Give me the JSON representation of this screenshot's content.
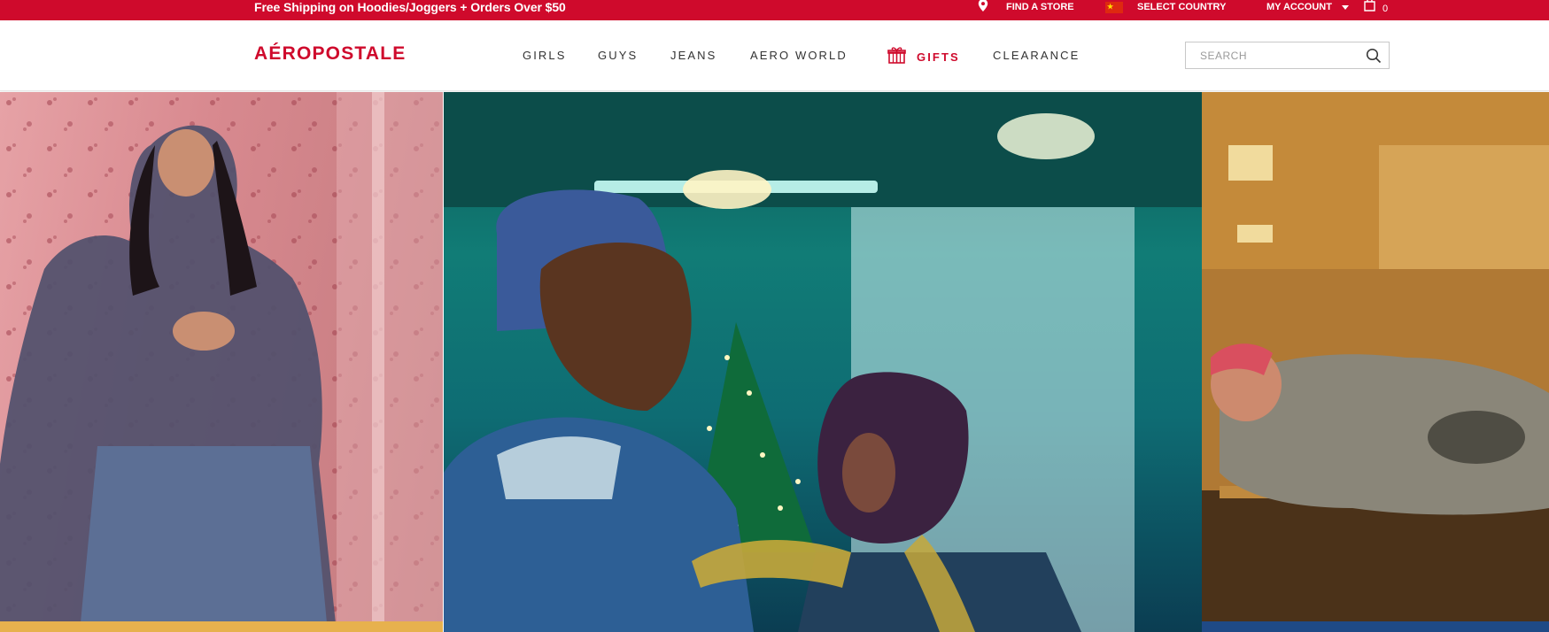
{
  "topbar": {
    "promo": "Free Shipping on Hoodies/Joggers + Orders Over $50",
    "find_store": "FIND A STORE",
    "select_country": "SELECT COUNTRY",
    "my_account": "MY ACCOUNT",
    "bag_count": "0"
  },
  "header": {
    "logo": "AÉROPOSTALE",
    "nav": [
      {
        "label": "GIRLS"
      },
      {
        "label": "GUYS"
      },
      {
        "label": "JEANS"
      },
      {
        "label": "AERO WORLD"
      },
      {
        "label": "GIFTS"
      },
      {
        "label": "CLEARANCE"
      }
    ],
    "search_placeholder": "SEARCH"
  },
  "colors": {
    "brand_red": "#cf0a2c",
    "nav_text": "#333333"
  },
  "icons": {
    "find_store": "map-pin-icon",
    "select_country": "flag-icon",
    "account": "caret-down-icon",
    "bag": "shopping-bag-icon",
    "gifts": "gift-icon",
    "search": "search-icon"
  }
}
